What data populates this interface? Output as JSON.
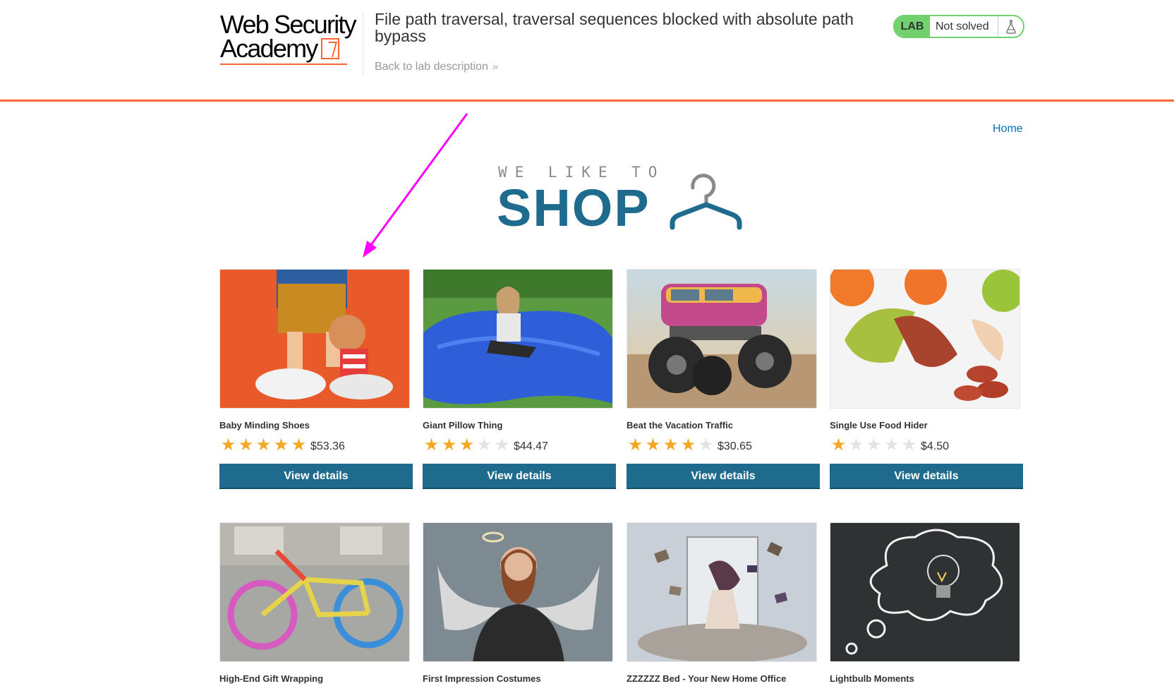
{
  "header": {
    "logo_line1": "Web Security",
    "logo_line2": "Academy",
    "lab_title": "File path traversal, traversal sequences blocked with absolute path bypass",
    "back_link": "Back to lab description",
    "status_badge": "LAB",
    "status_text": "Not solved",
    "accent_color": "#ff6633",
    "status_color": "#70d16d"
  },
  "nav": {
    "home": "Home"
  },
  "banner": {
    "tagline": "WE LIKE TO",
    "headline": "SHOP",
    "brand_color": "#1f6b8e"
  },
  "products": [
    {
      "name": "Baby Minding Shoes",
      "rating": 5,
      "price": "$53.36",
      "button": "View details",
      "image_colors": [
        "#e85a2a",
        "#c98a22"
      ],
      "icon": "shoes-image"
    },
    {
      "name": "Giant Pillow Thing",
      "rating": 3,
      "price": "$44.47",
      "button": "View details",
      "image_colors": [
        "#4f8f3a",
        "#2f5fd8"
      ],
      "icon": "pillow-image"
    },
    {
      "name": "Beat the Vacation Traffic",
      "rating": 4,
      "price": "$30.65",
      "button": "View details",
      "image_colors": [
        "#9bb8c9",
        "#c24a8a"
      ],
      "icon": "truck-image"
    },
    {
      "name": "Single Use Food Hider",
      "rating": 1,
      "price": "$4.50",
      "button": "View details",
      "image_colors": [
        "#f2f2f2",
        "#b5432e"
      ],
      "icon": "food-image"
    },
    {
      "name": "High-End Gift Wrapping",
      "image_colors": [
        "#9a9a96",
        "#d65ac0"
      ],
      "icon": "bicycle-image"
    },
    {
      "name": "First Impression Costumes",
      "image_colors": [
        "#7d8a91",
        "#2b2b2b"
      ],
      "icon": "angel-image"
    },
    {
      "name": "ZZZZZZ Bed - Your New Home Office",
      "image_colors": [
        "#c9cfd6",
        "#8a7a6a"
      ],
      "icon": "books-image"
    },
    {
      "name": "Lightbulb Moments",
      "image_colors": [
        "#2f3233",
        "#ffffff"
      ],
      "icon": "lightbulb-image"
    }
  ],
  "annotation": {
    "arrow_color": "#ff00ff"
  }
}
